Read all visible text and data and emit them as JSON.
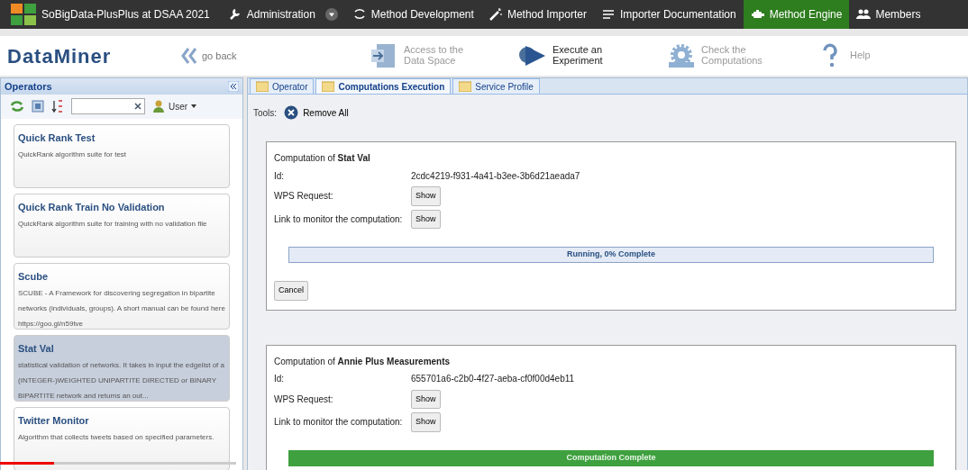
{
  "navbar": {
    "brand": "SoBigData-PlusPlus at DSAA 2021",
    "items": [
      {
        "label": "Administration",
        "dropdown": true,
        "selected": false
      },
      {
        "label": "Method Development",
        "dropdown": false,
        "selected": false
      },
      {
        "label": "Method Importer",
        "dropdown": false,
        "selected": false
      },
      {
        "label": "Importer Documentation",
        "dropdown": false,
        "selected": false
      },
      {
        "label": "Method Engine",
        "dropdown": false,
        "selected": true
      },
      {
        "label": "Members",
        "dropdown": false,
        "selected": false
      }
    ]
  },
  "header": {
    "logo": "DataMiner",
    "back": "go back",
    "menu": [
      {
        "label": "Access to the Data Space",
        "selected": false
      },
      {
        "label": "Execute an Experiment",
        "selected": true
      },
      {
        "label": "Check the Computations",
        "selected": false
      },
      {
        "label": "Help",
        "selected": false
      }
    ]
  },
  "operators": {
    "title": "Operators",
    "filter": "User",
    "items": [
      {
        "name": "Quick Rank Test",
        "description": "QuickRank algorithm suite for test",
        "selected": false
      },
      {
        "name": "Quick Rank Train No Validation",
        "description": "QuickRank algorithm suite for training with no validation file",
        "selected": false
      },
      {
        "name": "Scube",
        "description": "SCUBE - A Framework for discovering segregation in bipartite networks (individuals, groups). A short manual can be found here https://goo.gl/n59tve",
        "selected": false
      },
      {
        "name": "Stat Val",
        "description": "statistical validation of networks. It takes in input the edgelist of a (INTEGER-)WEIGHTED UNIPARTITE DIRECTED or BINARY BIPARTITE network and returns an out...",
        "selected": true
      },
      {
        "name": "Twitter Monitor",
        "description": "Algorithm that collects tweets based on specified parameters.",
        "selected": false
      }
    ]
  },
  "tabs": [
    {
      "label": "Operator",
      "selected": false
    },
    {
      "label": "Computations Execution",
      "selected": true
    },
    {
      "label": "Service Profile",
      "selected": false
    }
  ],
  "tools": {
    "label": "Tools:",
    "remove_all": "Remove All"
  },
  "computations": [
    {
      "title": "Computation of **Stat Val**",
      "id_label": "Id:",
      "id": "2cdc4219-f931-4a41-b3ee-3b6d21aeada7",
      "wps_label": "WPS Request:",
      "wps_button": "Show",
      "monitor_label": "Link to monitor the computation:",
      "monitor_button": "Show",
      "kind": "running",
      "level": 0,
      "progress_text": "Running, 0% Complete",
      "cancel": "Cancel"
    },
    {
      "title": "Computation of **Annie Plus Measurements**",
      "id_label": "Id:",
      "id": "655701a6-c2b0-4f27-aeba-cf0f00d4eb11",
      "wps_label": "WPS Request:",
      "wps_button": "Show",
      "monitor_label": "Link to monitor the computation:",
      "monitor_button": "Show",
      "kind": "complete",
      "level": 1,
      "progress_text": "Computation Complete"
    }
  ],
  "video_progress": {
    "level": 0.23
  }
}
